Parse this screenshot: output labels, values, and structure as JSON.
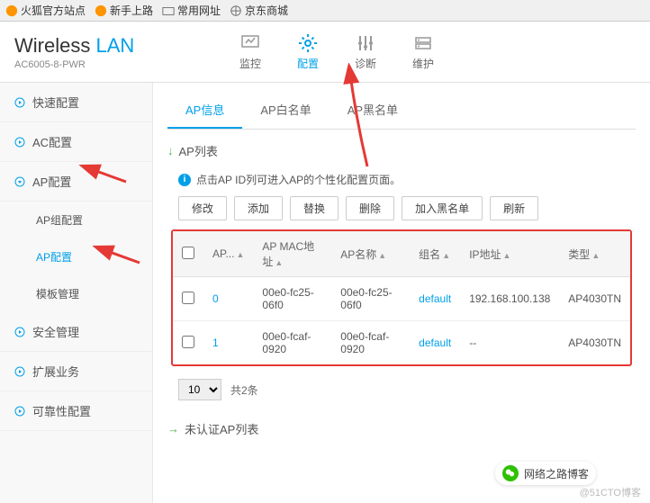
{
  "bookmarks": [
    {
      "label": "火狐官方站点"
    },
    {
      "label": "新手上路"
    },
    {
      "label": "常用网址"
    },
    {
      "label": "京东商城"
    }
  ],
  "brand": {
    "title_a": "Wireless ",
    "title_b": "LAN",
    "sub": "AC6005-8-PWR"
  },
  "topnav": [
    {
      "label": "监控",
      "icon": "monitor-icon"
    },
    {
      "label": "配置",
      "icon": "config-icon",
      "active": true
    },
    {
      "label": "诊断",
      "icon": "diagnose-icon"
    },
    {
      "label": "维护",
      "icon": "maintain-icon"
    }
  ],
  "sidebar": [
    {
      "label": "快速配置",
      "type": "top"
    },
    {
      "label": "AC配置",
      "type": "top"
    },
    {
      "label": "AP配置",
      "type": "top",
      "expanded": true
    },
    {
      "label": "AP组配置",
      "type": "sub"
    },
    {
      "label": "AP配置",
      "type": "sub",
      "active": true
    },
    {
      "label": "模板管理",
      "type": "sub"
    },
    {
      "label": "安全管理",
      "type": "top"
    },
    {
      "label": "扩展业务",
      "type": "top"
    },
    {
      "label": "可靠性配置",
      "type": "top"
    }
  ],
  "tabs": [
    {
      "label": "AP信息",
      "active": true
    },
    {
      "label": "AP白名单"
    },
    {
      "label": "AP黑名单"
    }
  ],
  "section_ap_list": "AP列表",
  "hint_text": "点击AP ID列可进入AP的个性化配置页面。",
  "buttons": {
    "modify": "修改",
    "add": "添加",
    "replace": "替换",
    "delete": "删除",
    "blacklist": "加入黑名单",
    "refresh": "刷新"
  },
  "table": {
    "cols": [
      "AP...",
      "AP MAC地址",
      "AP名称",
      "组名",
      "IP地址",
      "类型"
    ],
    "rows": [
      {
        "id": "0",
        "mac": "00e0-fc25-06f0",
        "name": "00e0-fc25-06f0",
        "group": "default",
        "ip": "192.168.100.138",
        "type": "AP4030TN"
      },
      {
        "id": "1",
        "mac": "00e0-fcaf-0920",
        "name": "00e0-fcaf-0920",
        "group": "default",
        "ip": "--",
        "type": "AP4030TN"
      }
    ]
  },
  "pager": {
    "size": "10",
    "total": "共2条"
  },
  "section_unauth": "未认证AP列表",
  "wechat": "网络之路博客",
  "watermark": "@51CTO博客"
}
